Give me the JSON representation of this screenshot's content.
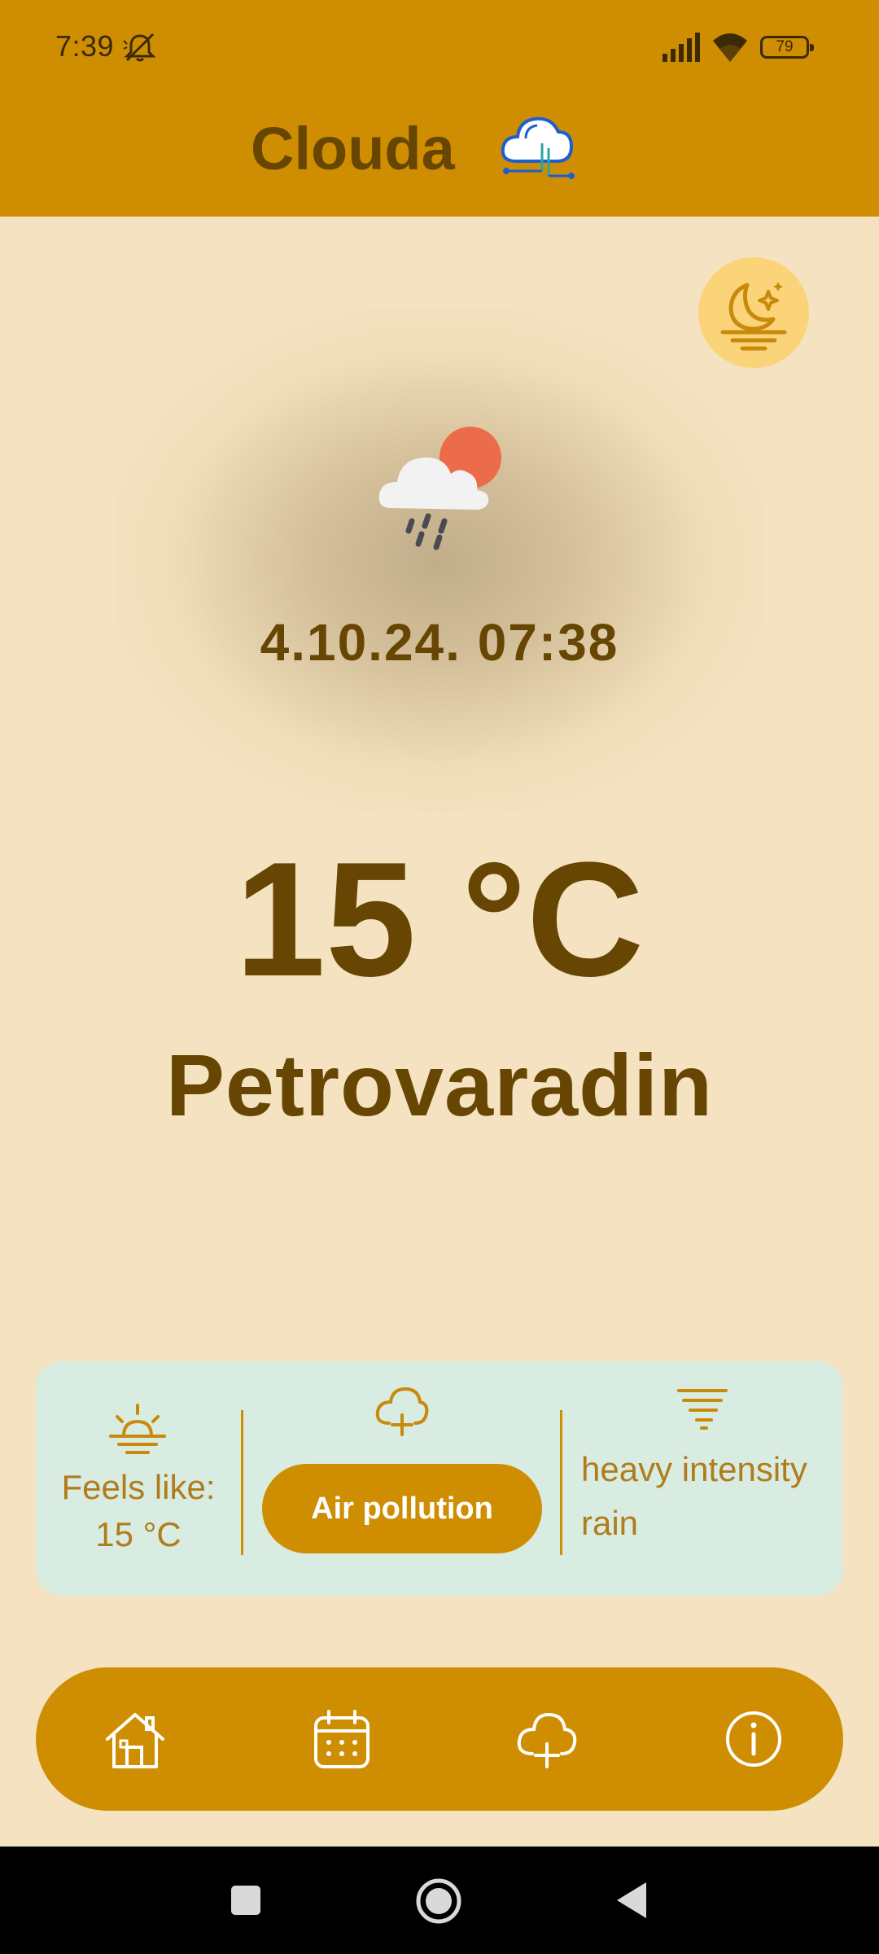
{
  "status_bar": {
    "time": "7:39",
    "battery": "79",
    "icons": [
      "mute-icon",
      "signal-icon",
      "wifi-icon",
      "battery-icon"
    ]
  },
  "app": {
    "title": "Clouda",
    "logo_icon": "cloud-logo-icon"
  },
  "theme_toggle": {
    "icon": "moon-icon"
  },
  "weather": {
    "icon": "cloud-rain-sun-icon",
    "datetime": "4.10.24. 07:38",
    "temperature": "15 °C",
    "city": "Petrovaradin"
  },
  "info_card": {
    "feels_label": "Feels like:",
    "feels_value": "15 °C",
    "air_pollution_label": "Air pollution",
    "description": "heavy intensity rain",
    "icons": [
      "sunrise-icon",
      "cloud-plus-icon",
      "tornado-icon"
    ]
  },
  "bottom_nav": {
    "items": [
      {
        "icon": "home-icon"
      },
      {
        "icon": "calendar-icon"
      },
      {
        "icon": "cloud-plus-icon"
      },
      {
        "icon": "info-icon"
      }
    ]
  },
  "colors": {
    "accent": "#cf8e01",
    "background": "#f4e2c0",
    "text_dark": "#664602",
    "card_bg": "#d8ece2",
    "card_text": "#b07c1c"
  }
}
